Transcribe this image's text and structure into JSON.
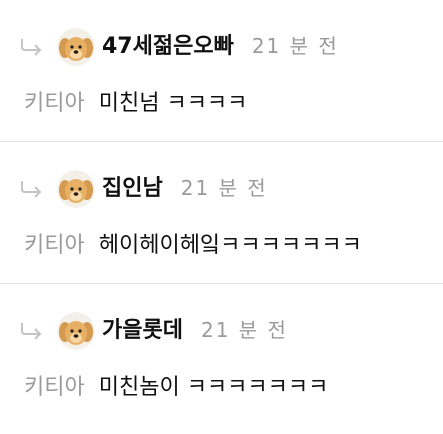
{
  "comments": [
    {
      "nickname": "47세젊은오빠",
      "time": "21 분 전",
      "mention": "키티아",
      "text": "미친넘 ㅋㅋㅋㅋ"
    },
    {
      "nickname": "집인남",
      "time": "21 분 전",
      "mention": "키티아",
      "text": "헤이헤이헤잌ㅋㅋㅋㅋㅋㅋㅋ"
    },
    {
      "nickname": "가을롯데",
      "time": "21 분 전",
      "mention": "키티아",
      "text": "미친놈이 ㅋㅋㅋㅋㅋㅋㅋ"
    }
  ],
  "icons": {
    "reply": "reply-arrow-icon",
    "avatar": "puppy-avatar"
  },
  "colors": {
    "text": "#111111",
    "muted": "#9a9a9a",
    "divider": "#e4e4e4",
    "avatar_bg": "#e8b064"
  }
}
